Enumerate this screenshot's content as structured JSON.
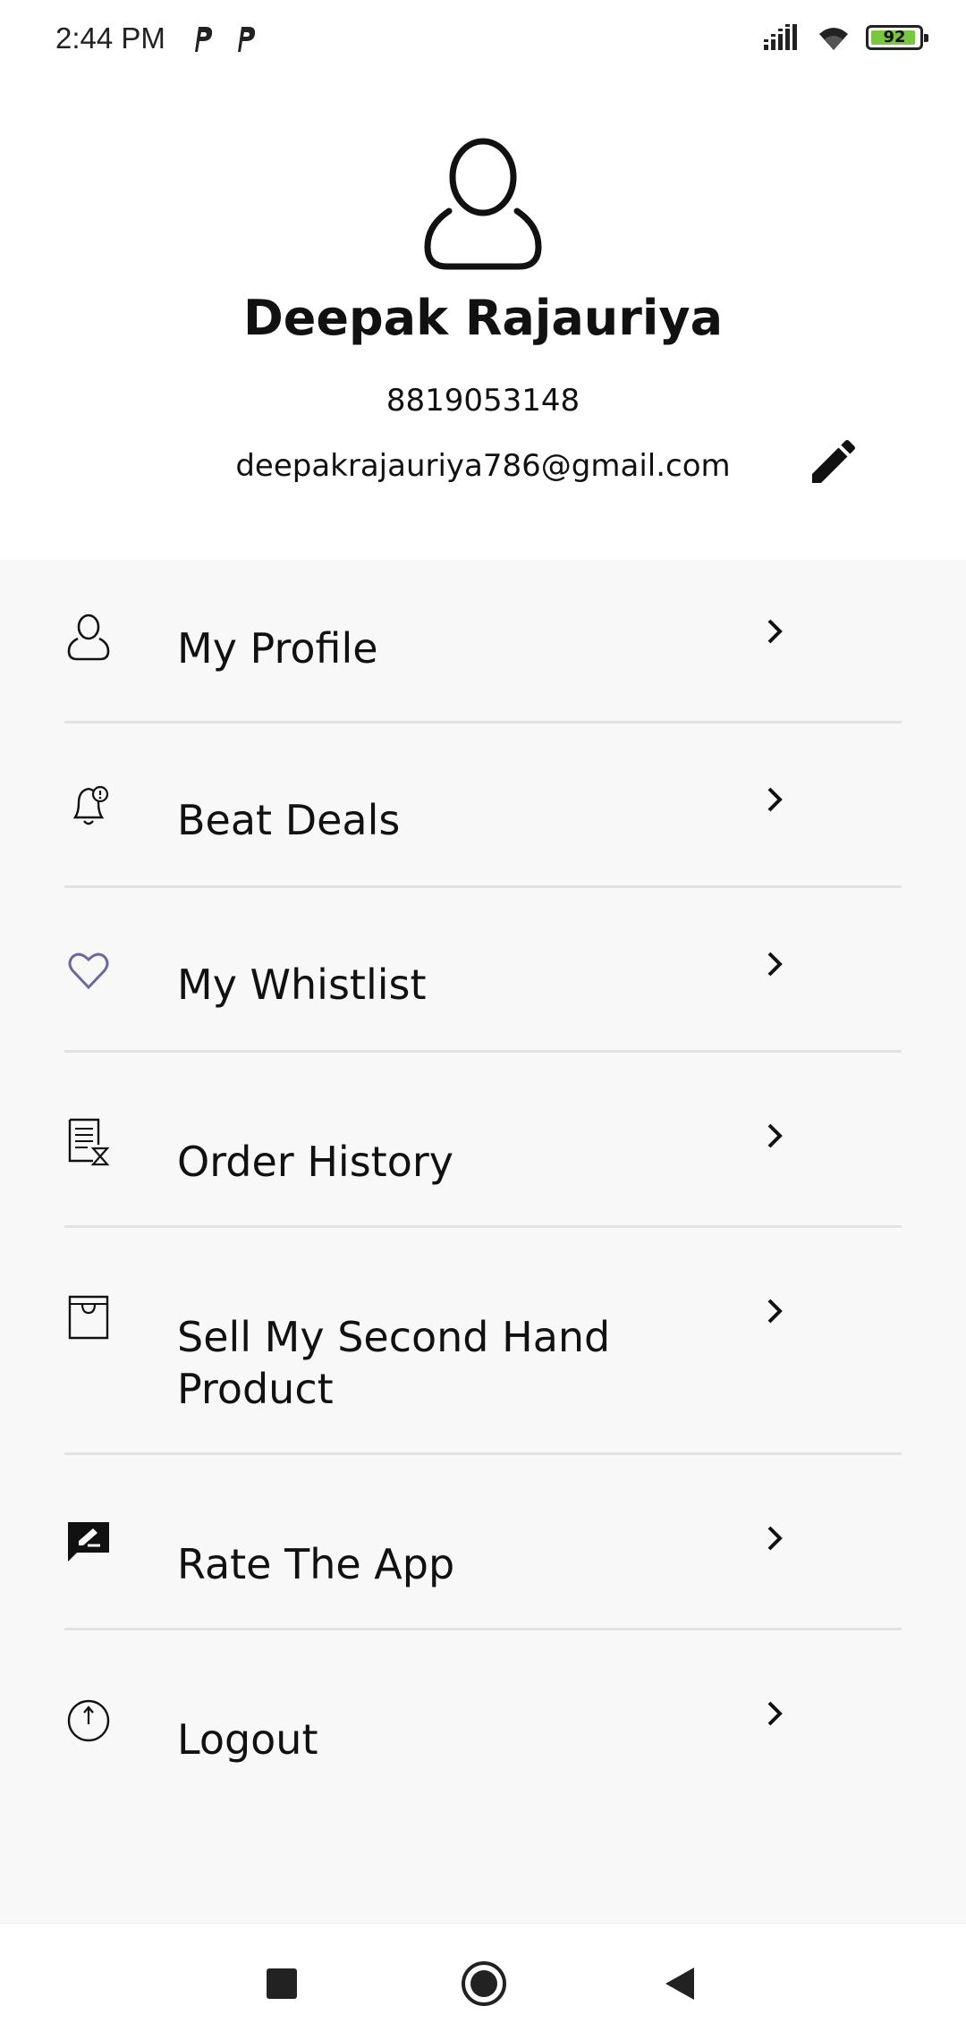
{
  "status_bar": {
    "time": "2:44 PM",
    "battery_level": "92",
    "battery_color": "#79c640",
    "icons": [
      "parking-notification-icon",
      "parking-notification-icon",
      "signal-icon",
      "wifi-icon",
      "battery-icon"
    ]
  },
  "profile": {
    "name": "Deepak Rajauriya",
    "phone": "8819053148",
    "email": "deepakrajauriya786@gmail.com",
    "avatar_icon": "user-outline-icon",
    "edit_icon": "pencil-icon"
  },
  "menu": {
    "items": [
      {
        "label": "My Profile",
        "icon": "user-icon"
      },
      {
        "label": "Beat Deals",
        "icon": "bell-alert-icon"
      },
      {
        "label": "My Whistlist",
        "icon": "heart-icon"
      },
      {
        "label": "Order History",
        "icon": "receipt-icon"
      },
      {
        "label": "Sell My Second Hand Product",
        "icon": "bag-icon"
      },
      {
        "label": "Rate The App",
        "icon": "rate-review-icon"
      },
      {
        "label": "Logout",
        "icon": "power-icon"
      }
    ]
  },
  "nav_bar": {
    "buttons": [
      "recents-square-icon",
      "home-circle-icon",
      "back-triangle-icon"
    ]
  },
  "colors": {
    "menu_background": "#f8f8f8",
    "divider": "#e2e2e2",
    "heart_accent": "#6a6a9a"
  }
}
